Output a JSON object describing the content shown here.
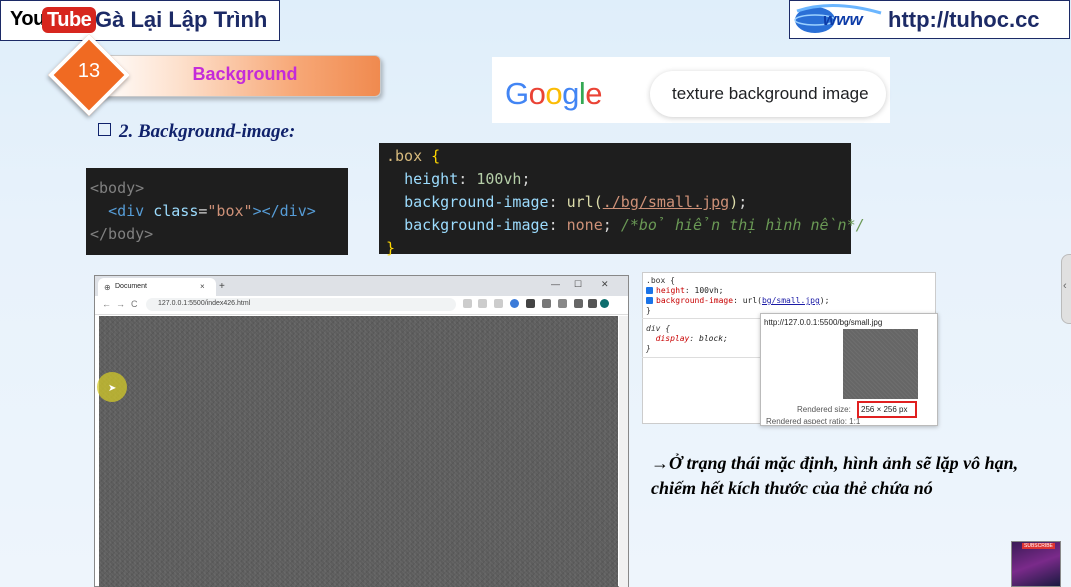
{
  "header": {
    "youtube_you": "You",
    "youtube_tube": "Tube",
    "channel_name": "Gà Lại Lập Trình",
    "site_url": "http://tuhoc.cc",
    "www_logo_text": "www"
  },
  "lesson": {
    "number": "13",
    "title": "Background"
  },
  "google": {
    "logo": "Google",
    "search_query": "texture background image",
    "colors": [
      "#4285F4",
      "#EA4335",
      "#FBBC05",
      "#4285F4",
      "#34A853",
      "#EA4335"
    ]
  },
  "section_heading": "2. Background-image:",
  "html_code": {
    "line1_tag": "<body>",
    "line2_open": "<div",
    "line2_attr": "class",
    "line2_eq": "=",
    "line2_value": "\"box\"",
    "line2_close": "></div>",
    "line3_tag": "</body>"
  },
  "css_code": {
    "selector": ".box",
    "open_brace": "{",
    "close_brace": "}",
    "prop1": "height",
    "val1": "100vh",
    "prop2": "background-image",
    "val2_fn": "url(",
    "val2_path": "./bg/small.jpg",
    "val2_end": ")",
    "prop3": "background-image",
    "val3": "none",
    "comment3": "/*bỏ hiển thị hình nền*/"
  },
  "browser": {
    "tab_title": "Document",
    "tab_close": "×",
    "new_tab": "+",
    "address": "127.0.0.1:5500/index426.html",
    "nav_back": "←",
    "nav_forward": "→",
    "nav_reload": "C",
    "window_minimize": "—",
    "window_maximize": "☐",
    "window_close": "✕"
  },
  "devtools": {
    "rule1_selector": ".box {",
    "rule1_prop1": "height",
    "rule1_val1": "100vh;",
    "rule1_prop2": "background-image",
    "rule1_val2_pre": "url(",
    "rule1_val2_link": "bg/small.jpg",
    "rule1_val2_post": ");",
    "rule1_close": "}",
    "rule2_selector": "div {",
    "rule2_prop": "display",
    "rule2_val": "block;",
    "rule2_close": "}",
    "tooltip_url": "http://127.0.0.1:5500/bg/small.jpg",
    "rendered_size_label": "Rendered size:",
    "rendered_size_value": "256 × 256 px",
    "rendered_aspect_label": "Rendered aspect ratio: 1:1"
  },
  "note_text": "→Ở trạng thái mặc định, hình ảnh sẽ lặp vô hạn, chiếm hết kích thước của thẻ chứa nó",
  "avatar_badge": "SUBSCRIBE",
  "side_chevron": "‹"
}
